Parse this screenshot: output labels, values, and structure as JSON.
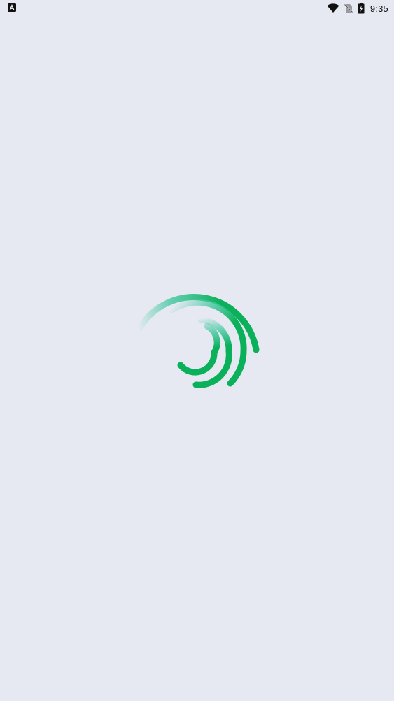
{
  "status_bar": {
    "time": "9:35",
    "notification_icon": "font-a-icon",
    "icons": [
      "wifi-icon",
      "no-sim-icon",
      "battery-charging-icon"
    ]
  },
  "loader": {
    "icon": "spinner-icon",
    "accent_color": "#0bb05a",
    "fade_color": "#43c8a0",
    "background_color": "#e6e9f2"
  }
}
